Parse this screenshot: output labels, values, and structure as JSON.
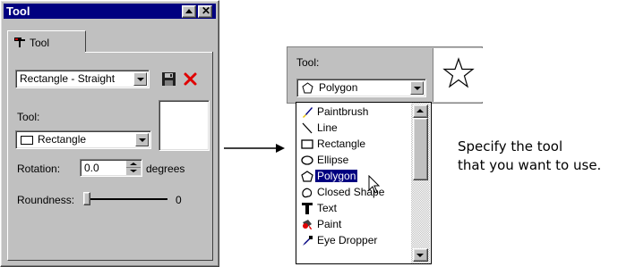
{
  "panel": {
    "title": "Tool",
    "tab_label": "Tool",
    "preset_value": "Rectangle - Straight",
    "tool_label": "Tool:",
    "tool_value": "Rectangle",
    "rotation_label": "Rotation:",
    "rotation_value": "0.0",
    "rotation_unit": "degrees",
    "roundness_label": "Roundness:",
    "roundness_value": "0",
    "roundness_level": 0
  },
  "dropdown": {
    "tool_label": "Tool:",
    "selected_value": "Polygon",
    "items": [
      {
        "label": "Paintbrush",
        "icon": "paintbrush-icon"
      },
      {
        "label": "Line",
        "icon": "line-icon"
      },
      {
        "label": "Rectangle",
        "icon": "rectangle-icon"
      },
      {
        "label": "Ellipse",
        "icon": "ellipse-icon"
      },
      {
        "label": "Polygon",
        "icon": "polygon-icon"
      },
      {
        "label": "Closed Shape",
        "icon": "closed-shape-icon"
      },
      {
        "label": "Text",
        "icon": "text-icon"
      },
      {
        "label": "Paint",
        "icon": "paint-icon"
      },
      {
        "label": "Eye Dropper",
        "icon": "eye-dropper-icon"
      }
    ],
    "highlighted_index": 4
  },
  "callout": {
    "line1": "Specify the tool",
    "line2": "that you want to use."
  },
  "colors": {
    "titlebar": "#000080",
    "face": "#c0c0c0",
    "selection": "#000080",
    "delete": "#e00000"
  }
}
